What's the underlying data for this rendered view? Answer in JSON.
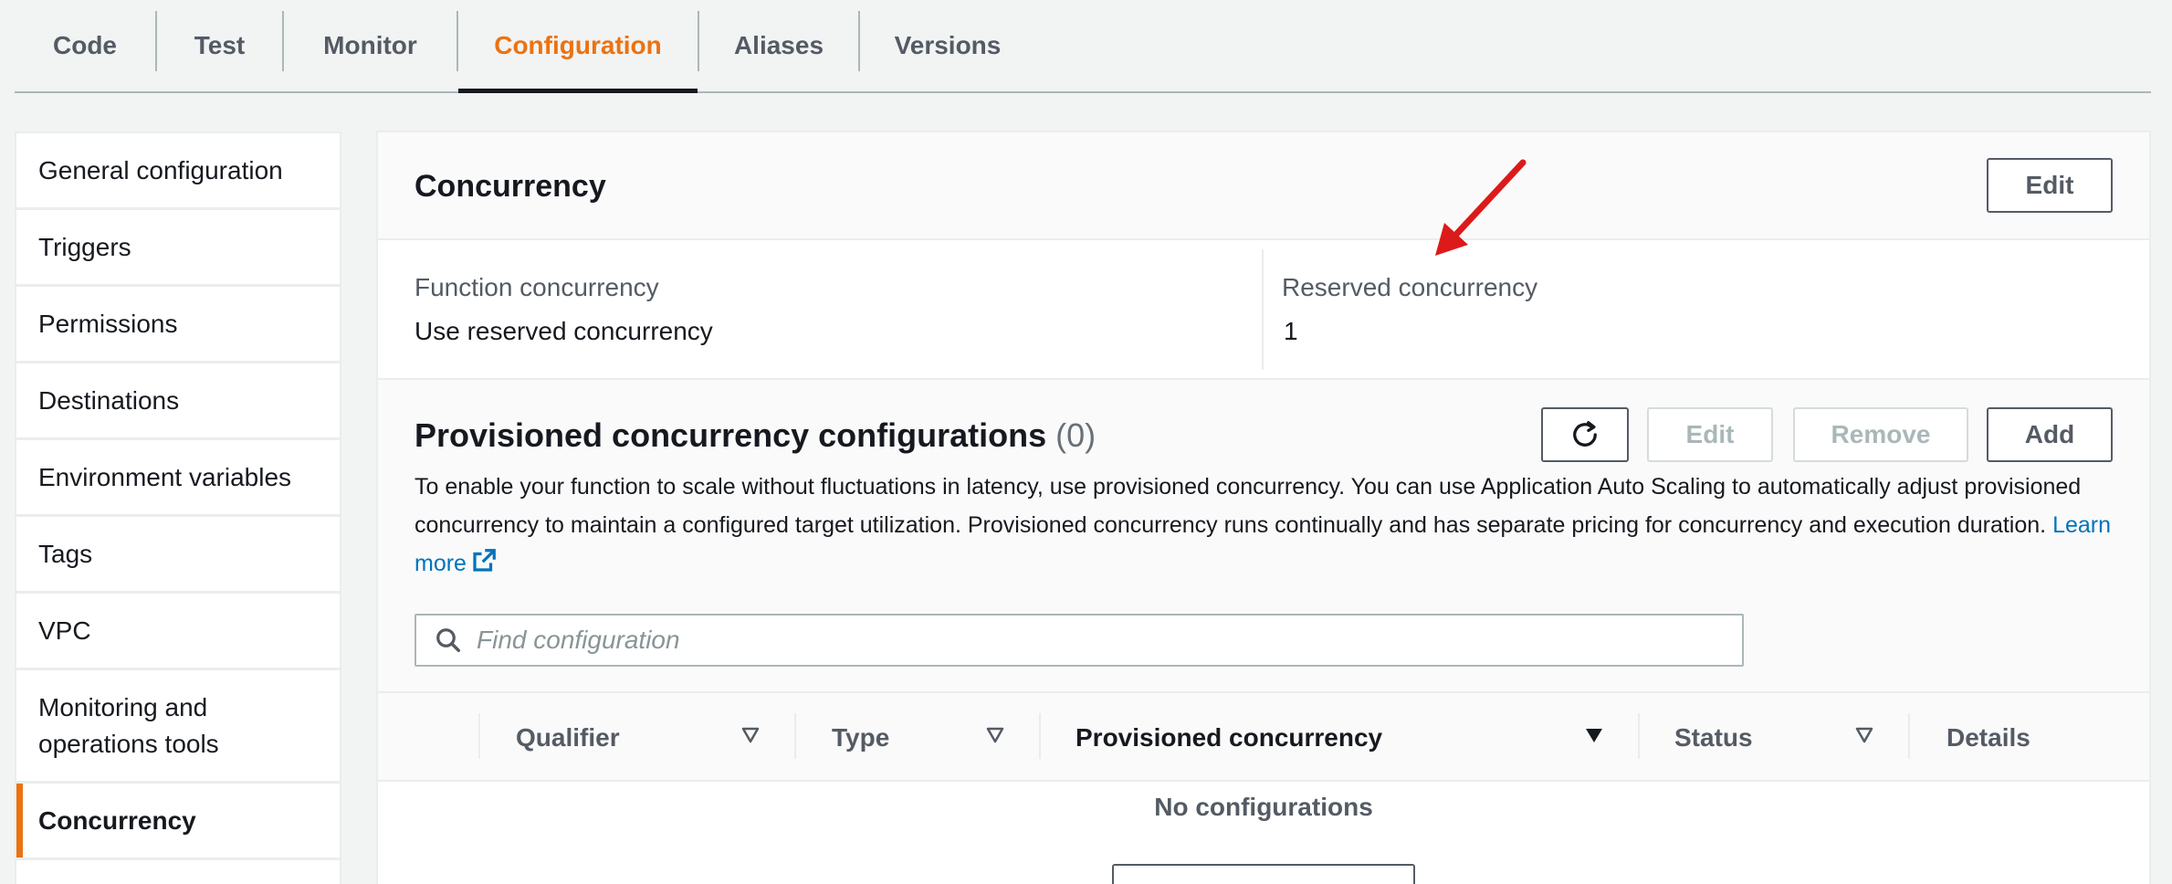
{
  "tabs": [
    {
      "label": "Code"
    },
    {
      "label": "Test"
    },
    {
      "label": "Monitor"
    },
    {
      "label": "Configuration",
      "active": true
    },
    {
      "label": "Aliases"
    },
    {
      "label": "Versions"
    }
  ],
  "sidebar": {
    "items": [
      {
        "label": "General configuration"
      },
      {
        "label": "Triggers"
      },
      {
        "label": "Permissions"
      },
      {
        "label": "Destinations"
      },
      {
        "label": "Environment variables"
      },
      {
        "label": "Tags"
      },
      {
        "label": "VPC"
      },
      {
        "label": "Monitoring and operations tools"
      },
      {
        "label": "Concurrency",
        "active": true
      }
    ]
  },
  "concurrency": {
    "title": "Concurrency",
    "edit_label": "Edit",
    "function_concurrency_label": "Function concurrency",
    "function_concurrency_value": "Use reserved concurrency",
    "reserved_concurrency_label": "Reserved concurrency",
    "reserved_concurrency_value": "1"
  },
  "provisioned": {
    "title": "Provisioned concurrency configurations",
    "count": "(0)",
    "edit_label": "Edit",
    "remove_label": "Remove",
    "add_label": "Add",
    "description": "To enable your function to scale without fluctuations in latency, use provisioned concurrency. You can use Application Auto Scaling to automatically adjust provisioned concurrency to maintain a configured target utilization. Provisioned concurrency runs continually and has separate pricing for concurrency and execution duration.",
    "learn_more": "Learn more",
    "search_placeholder": "Find configuration",
    "columns": [
      "Qualifier",
      "Type",
      "Provisioned concurrency",
      "Status",
      "Details"
    ],
    "empty_text": "No configurations"
  },
  "colors": {
    "accent": "#ec7211",
    "link": "#0073bb",
    "annotation_arrow": "#dd1a1a"
  }
}
